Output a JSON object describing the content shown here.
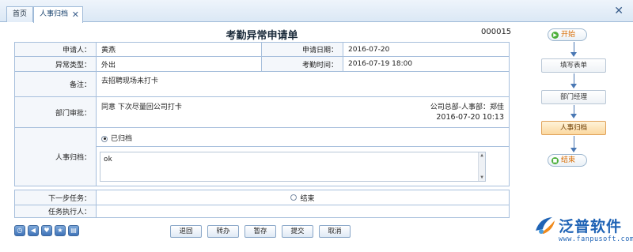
{
  "tabs": {
    "home": "首页",
    "active": "人事归档"
  },
  "form": {
    "title": "考勤异常申请单",
    "number": "000015",
    "applicant_label": "申请人：",
    "applicant": "黄燕",
    "apply_date_label": "申请日期：",
    "apply_date": "2016-07-20",
    "type_label": "异常类型：",
    "type": "外出",
    "att_time_label": "考勤时间：",
    "att_time": "2016-07-19 18:00",
    "remark_label": "备注：",
    "remark": "去招聘现场未打卡",
    "dept_label": "部门审批：",
    "dept_comment": "同意   下次尽量回公司打卡",
    "dept_signer": "公司总部-人事部：郑佳",
    "dept_date": "2016-07-20 10:13",
    "hr_label": "人事归档：",
    "hr_option": "已归档",
    "hr_comment": "ok"
  },
  "next": {
    "task_label": "下一步任务：",
    "task_option": "结束",
    "executor_label": "任务执行人："
  },
  "flow": {
    "start": "开始",
    "step1": "填写表单",
    "step2": "部门经理",
    "step3": "人事归档",
    "end": "结束"
  },
  "buttons": {
    "back": "退回",
    "transfer": "转办",
    "save": "暂存",
    "submit": "提交",
    "cancel": "取消"
  },
  "logo": {
    "name": "泛普软件",
    "url": "www.fanpusoft.com"
  },
  "colors": {
    "accent": "#1f63b5",
    "border": "#a7bfdc",
    "current_step": "#fbd8a0"
  }
}
